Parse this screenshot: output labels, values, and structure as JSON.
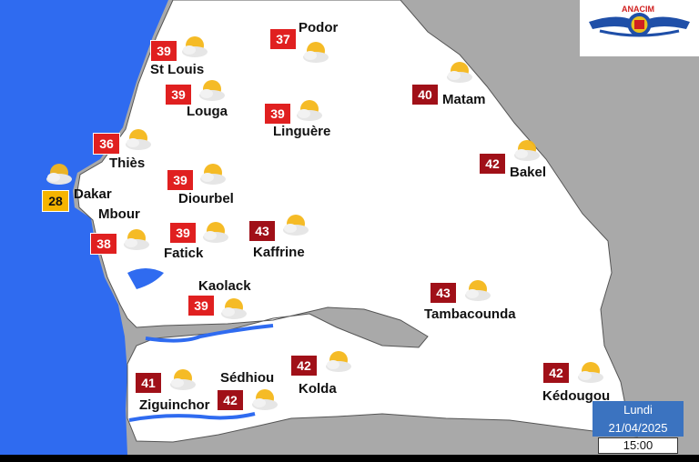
{
  "cities": [
    {
      "name": "St Louis",
      "temp": "39",
      "style": "red"
    },
    {
      "name": "Podor",
      "temp": "37",
      "style": "red"
    },
    {
      "name": "Louga",
      "temp": "39",
      "style": "red"
    },
    {
      "name": "Linguère",
      "temp": "39",
      "style": "red"
    },
    {
      "name": "Matam",
      "temp": "40",
      "style": "dark"
    },
    {
      "name": "Thiès",
      "temp": "36",
      "style": "red"
    },
    {
      "name": "Bakel",
      "temp": "42",
      "style": "dark"
    },
    {
      "name": "Dakar",
      "temp": "28",
      "style": "amber"
    },
    {
      "name": "Diourbel",
      "temp": "39",
      "style": "red"
    },
    {
      "name": "Mbour",
      "temp": "38",
      "style": "red"
    },
    {
      "name": "Fatick",
      "temp": "39",
      "style": "red"
    },
    {
      "name": "Kaffrine",
      "temp": "43",
      "style": "dark"
    },
    {
      "name": "Kaolack",
      "temp": "39",
      "style": "red"
    },
    {
      "name": "Tambacounda",
      "temp": "43",
      "style": "dark"
    },
    {
      "name": "Kolda",
      "temp": "42",
      "style": "dark"
    },
    {
      "name": "Sédhiou",
      "temp": "42",
      "style": "dark"
    },
    {
      "name": "Ziguinchor",
      "temp": "41",
      "style": "dark"
    },
    {
      "name": "Kédougou",
      "temp": "42",
      "style": "dark"
    }
  ],
  "weather_icon": "partly-sunny-icon",
  "logo": {
    "text": "ANACIM",
    "icon": "anacim-logo-icon"
  },
  "date": {
    "day": "Lundi",
    "date": "21/04/2025",
    "time": "15:00"
  },
  "colors": {
    "sea": "#2f6bf0",
    "land": "#ffffff",
    "neighbors": "#a9a9a9",
    "temp_red": "#e02020",
    "temp_dark": "#a01018",
    "temp_amber": "#f5b400",
    "date_box": "#3b73c0"
  }
}
